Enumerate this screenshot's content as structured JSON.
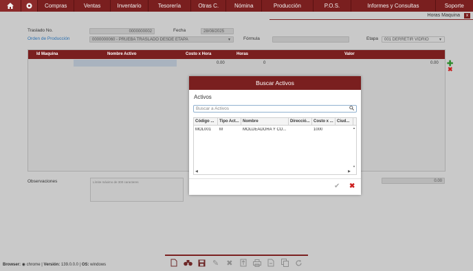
{
  "nav": {
    "items": [
      "Compras",
      "Ventas",
      "Inventario",
      "Tesorería",
      "Otras C.",
      "Nómina",
      "Producción",
      "P.O.S.",
      "Informes y Consultas",
      "Soporte"
    ]
  },
  "window": {
    "title": "Horas Maquina",
    "close": "x"
  },
  "form": {
    "traslado_label": "Traslado No.",
    "traslado_value": "0000000002",
    "fecha_label": "Fecha",
    "fecha_value": "28/08/2025",
    "orden_label": "Orden de Producción",
    "orden_value": "0000000060 - PRUEBA TRASLADO DESDE ETAPA",
    "formula_label": "Fórmula",
    "formula_value": "",
    "etapa_label": "Etapa",
    "etapa_value": "001 DERRETIR VIDRIO"
  },
  "grid": {
    "columns": [
      "Id Maquina",
      "Nombre Activo",
      "Costo x Hora",
      "Horas",
      "Valor"
    ],
    "row": {
      "costo": "0.00",
      "horas": "0",
      "valor": "0.00"
    }
  },
  "observaciones": {
    "label": "Observaciones",
    "placeholder": "Límite máximo de 300 caracteres",
    "total": "0.00"
  },
  "modal": {
    "title": "Buscar Activos",
    "subtitle": "Activos",
    "search_placeholder": "Buscar a Activos",
    "columns": [
      "Código ...",
      "Tipo Act...",
      "Nombre",
      "Direcció...",
      "Costo x ...",
      "Ciud..."
    ],
    "rows": [
      {
        "codigo": "MOL001",
        "tipo": "M",
        "nombre": "MOLDEADORA Y CO...",
        "direccion": "",
        "costo": "1000",
        "ciudad": ""
      }
    ]
  },
  "footer": {
    "browser_label": "Browser:",
    "browser_value": "chrome",
    "version_label": "Versión:",
    "version_value": "139.0.0.0",
    "os_label": "OS:",
    "os_value": "windows"
  }
}
